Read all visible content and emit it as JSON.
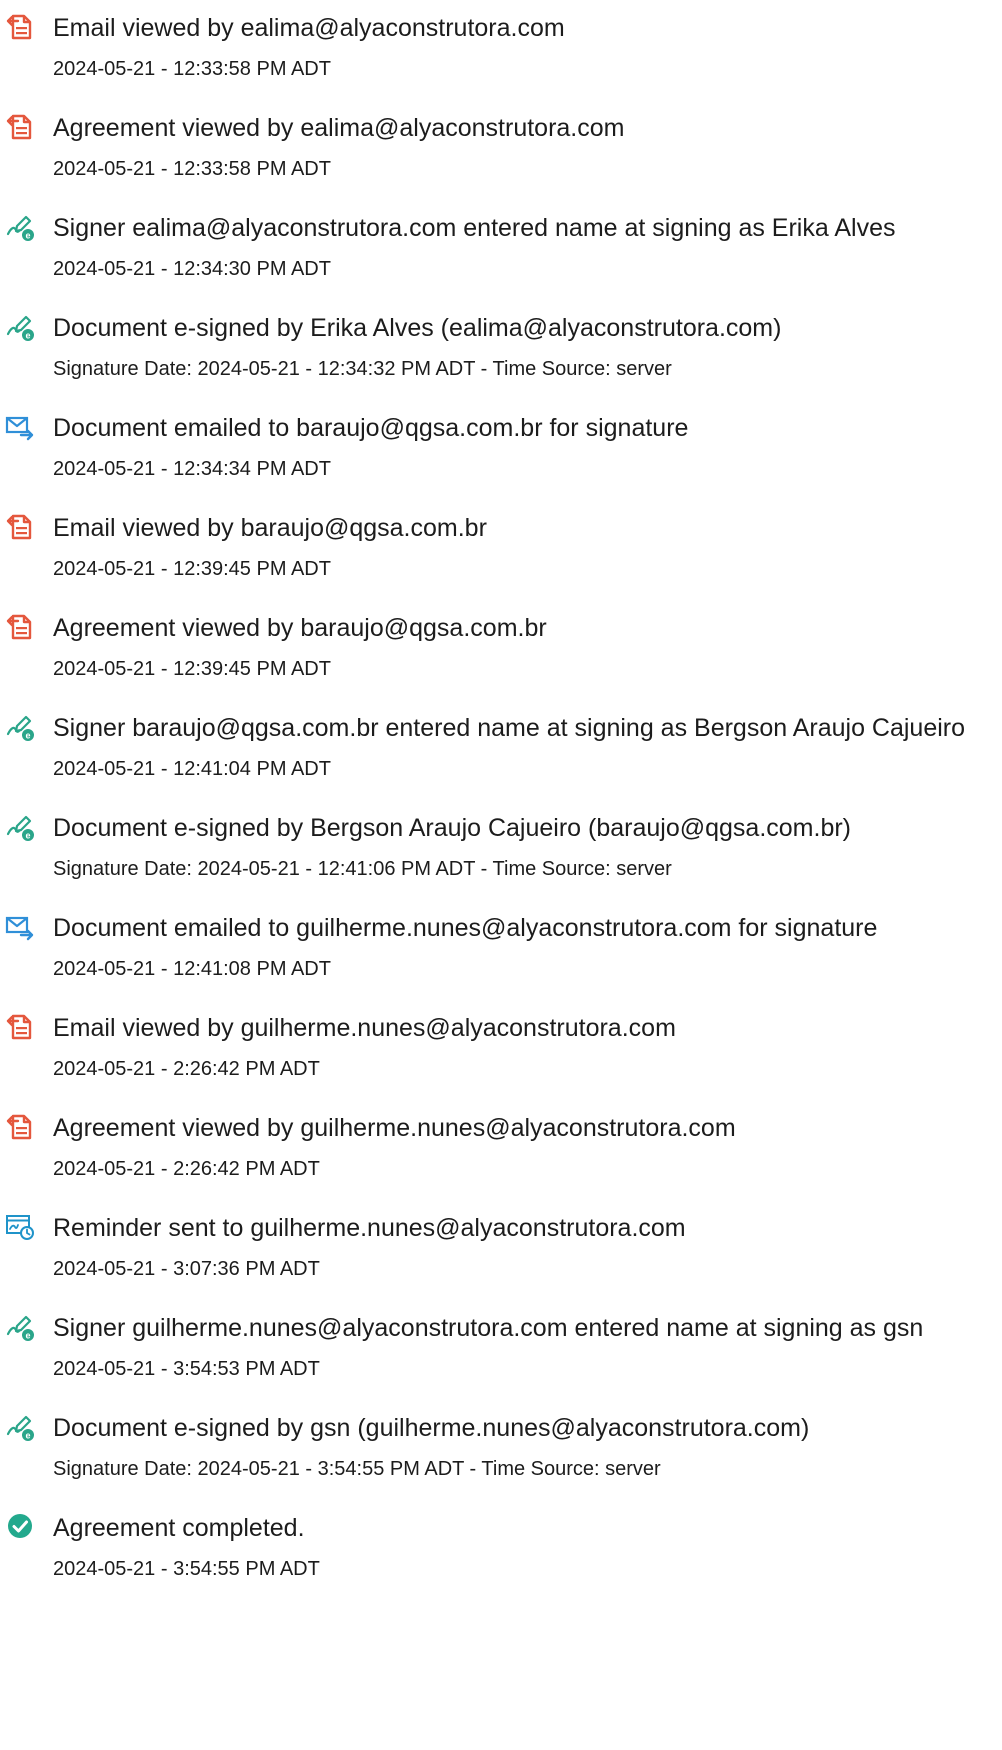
{
  "events": [
    {
      "icon": "document-viewed-icon",
      "title": "Email viewed by ealima@alyaconstrutora.com",
      "sub": "2024-05-21 - 12:33:58 PM ADT"
    },
    {
      "icon": "document-viewed-icon",
      "title": "Agreement viewed by ealima@alyaconstrutora.com",
      "sub": "2024-05-21 - 12:33:58 PM ADT"
    },
    {
      "icon": "e-sign-pen-icon",
      "title": "Signer ealima@alyaconstrutora.com entered name at signing as Erika Alves",
      "sub": "2024-05-21 - 12:34:30 PM ADT"
    },
    {
      "icon": "e-sign-pen-icon",
      "title": "Document e-signed by Erika Alves (ealima@alyaconstrutora.com)",
      "sub": "Signature Date: 2024-05-21 - 12:34:32 PM ADT - Time Source: server"
    },
    {
      "icon": "email-sent-icon",
      "title": "Document emailed to baraujo@qgsa.com.br for signature",
      "sub": "2024-05-21 - 12:34:34 PM ADT"
    },
    {
      "icon": "document-viewed-icon",
      "title": "Email viewed by baraujo@qgsa.com.br",
      "sub": "2024-05-21 - 12:39:45 PM ADT"
    },
    {
      "icon": "document-viewed-icon",
      "title": "Agreement viewed by baraujo@qgsa.com.br",
      "sub": "2024-05-21 - 12:39:45 PM ADT"
    },
    {
      "icon": "e-sign-pen-icon",
      "title": "Signer baraujo@qgsa.com.br entered name at signing as Bergson Araujo Cajueiro",
      "sub": "2024-05-21 - 12:41:04 PM ADT"
    },
    {
      "icon": "e-sign-pen-icon",
      "title": "Document e-signed by Bergson Araujo Cajueiro (baraujo@qgsa.com.br)",
      "sub": "Signature Date: 2024-05-21 - 12:41:06 PM ADT - Time Source: server"
    },
    {
      "icon": "email-sent-icon",
      "title": "Document emailed to guilherme.nunes@alyaconstrutora.com for signature",
      "sub": "2024-05-21 - 12:41:08 PM ADT"
    },
    {
      "icon": "document-viewed-icon",
      "title": "Email viewed by guilherme.nunes@alyaconstrutora.com",
      "sub": "2024-05-21 - 2:26:42 PM ADT"
    },
    {
      "icon": "document-viewed-icon",
      "title": "Agreement viewed by guilherme.nunes@alyaconstrutora.com",
      "sub": "2024-05-21 - 2:26:42 PM ADT"
    },
    {
      "icon": "reminder-icon",
      "title": "Reminder sent to guilherme.nunes@alyaconstrutora.com",
      "sub": "2024-05-21 - 3:07:36 PM ADT"
    },
    {
      "icon": "e-sign-pen-icon",
      "title": "Signer guilherme.nunes@alyaconstrutora.com entered name at signing as gsn",
      "sub": "2024-05-21 - 3:54:53 PM ADT"
    },
    {
      "icon": "e-sign-pen-icon",
      "title": "Document e-signed by gsn (guilherme.nunes@alyaconstrutora.com)",
      "sub": "Signature Date: 2024-05-21 - 3:54:55 PM ADT - Time Source: server"
    },
    {
      "icon": "check-circle-icon",
      "title": "Agreement completed.",
      "sub": "2024-05-21 - 3:54:55 PM ADT"
    }
  ],
  "colors": {
    "document_icon": "#e4573d",
    "esign_icon": "#2aa58a",
    "email_icon": "#2f8fd8",
    "reminder_icon": "#1f93c9",
    "completed_icon": "#23a98d"
  }
}
